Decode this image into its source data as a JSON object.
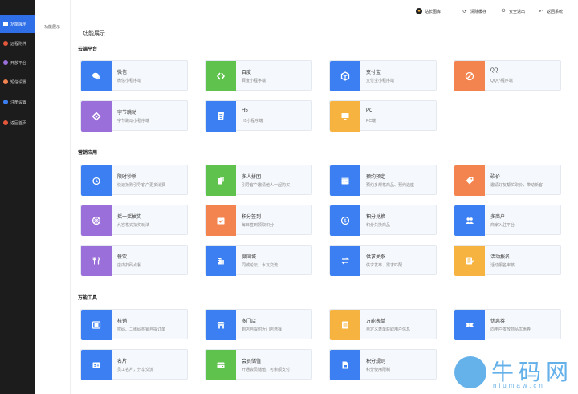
{
  "sidebar": {
    "items": [
      {
        "label": "功能展示",
        "icon": "grid-icon",
        "color": "#ffffff",
        "active": true
      },
      {
        "label": "远程附件",
        "icon": "attachment-icon",
        "color": "#e4573a"
      },
      {
        "label": "开放平台",
        "icon": "platform-icon",
        "color": "#9b6fd9"
      },
      {
        "label": "短信设置",
        "icon": "sms-icon",
        "color": "#f3844f"
      },
      {
        "label": "注册设置",
        "icon": "register-icon",
        "color": "#3b7ff2"
      },
      {
        "label": "返回首页",
        "icon": "home-icon",
        "color": "#e4573a"
      }
    ]
  },
  "subnav": {
    "item": "功能展示"
  },
  "topbar": {
    "items": [
      {
        "label": "站长图库",
        "icon": "avatar-icon"
      },
      {
        "label": "清除缓存",
        "icon": "refresh-icon"
      },
      {
        "label": "安全退出",
        "icon": "logout-icon"
      },
      {
        "label": "返回系统",
        "icon": "back-icon"
      }
    ]
  },
  "page": {
    "title": "功能展示"
  },
  "sections": [
    {
      "title": "云端平台",
      "cards": [
        {
          "title": "微信",
          "desc": "微信小程序端",
          "color": "blue",
          "icon": "wechat-icon"
        },
        {
          "title": "百度",
          "desc": "百度小程序端",
          "color": "green",
          "icon": "baidu-icon"
        },
        {
          "title": "支付宝",
          "desc": "支付宝小程序端",
          "color": "blue",
          "icon": "alipay-icon"
        },
        {
          "title": "QQ",
          "desc": "QQ小程序端",
          "color": "orange",
          "icon": "qq-icon"
        },
        {
          "title": "字节跳动",
          "desc": "字节跳动小程序端",
          "color": "purple",
          "icon": "bytedance-icon"
        },
        {
          "title": "H5",
          "desc": "H5小程序端",
          "color": "blue",
          "icon": "h5-icon"
        },
        {
          "title": "PC",
          "desc": "PC端",
          "color": "yellow",
          "icon": "pc-icon"
        }
      ]
    },
    {
      "title": "营销应用",
      "cards": [
        {
          "title": "限时秒杀",
          "desc": "快速抢购引导客户更多消费",
          "color": "blue",
          "icon": "clock-icon"
        },
        {
          "title": "多人拼团",
          "desc": "引导客户邀请他人一起购买",
          "color": "green",
          "icon": "group-icon"
        },
        {
          "title": "预约预定",
          "desc": "预约多规格商品、预约选座",
          "color": "blue",
          "icon": "calendar-icon"
        },
        {
          "title": "砍价",
          "desc": "邀请好友帮忙砍价，带动新客",
          "color": "orange",
          "icon": "tag-icon"
        },
        {
          "title": "摇一摇抽奖",
          "desc": "九宫格式抽奖玩法",
          "color": "purple",
          "icon": "lottery-icon"
        },
        {
          "title": "积分签到",
          "desc": "每日签到领取积分",
          "color": "orange",
          "icon": "checkin-icon"
        },
        {
          "title": "积分兑换",
          "desc": "积分兑换商品",
          "color": "blue",
          "icon": "coin-icon"
        },
        {
          "title": "多商户",
          "desc": "商家入驻平台",
          "color": "blue",
          "icon": "merchant-icon"
        },
        {
          "title": "餐饮",
          "desc": "店内扫码点餐",
          "color": "purple",
          "icon": "dining-icon"
        },
        {
          "title": "微同城",
          "desc": "同城论坛、水友交流",
          "color": "blue",
          "icon": "city-icon"
        },
        {
          "title": "供求关系",
          "desc": "供求发布、需求匹配",
          "color": "blue",
          "icon": "exchange-icon"
        },
        {
          "title": "活动报名",
          "desc": "活动报名审核",
          "color": "yellow",
          "icon": "form-icon"
        }
      ]
    },
    {
      "title": "万能工具",
      "cards": [
        {
          "title": "核销",
          "desc": "密码、二维码核销自提订单",
          "color": "blue",
          "icon": "scan-icon"
        },
        {
          "title": "多门店",
          "desc": "到店自提附近门店选择",
          "color": "blue",
          "icon": "store-icon"
        },
        {
          "title": "万能表单",
          "desc": "自定义表单获取用户信息",
          "color": "yellow",
          "icon": "doc-icon"
        },
        {
          "title": "优惠券",
          "desc": "向用户发放商品优惠券",
          "color": "blue",
          "icon": "coupon-icon"
        },
        {
          "title": "名片",
          "desc": "员工名片，分享交流",
          "color": "blue",
          "icon": "card-icon"
        },
        {
          "title": "会员储值",
          "desc": "开通会员储值，可余额支付",
          "color": "green",
          "icon": "wallet-icon"
        },
        {
          "title": "积分规则",
          "desc": "积分使用限制",
          "color": "blue",
          "icon": "rule-icon"
        }
      ]
    }
  ],
  "watermark": {
    "text": "牛码网",
    "sub": "niumaw.cn"
  }
}
